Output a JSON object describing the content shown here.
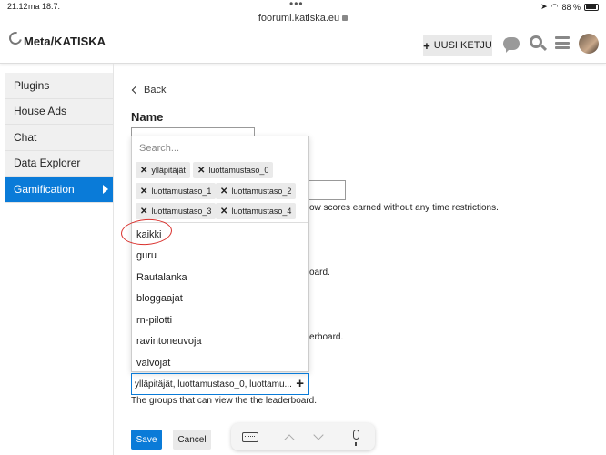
{
  "status": {
    "time": "21.12",
    "date": "ma 18.7.",
    "battery": "88 %"
  },
  "browser": {
    "url": "foorumi.katiska.eu"
  },
  "header": {
    "logo_text": "Meta/KATISKA",
    "new_topic_label": "UUSI KETJU"
  },
  "sidebar": {
    "items": [
      {
        "label": "Plugins"
      },
      {
        "label": "House Ads"
      },
      {
        "label": "Chat"
      },
      {
        "label": "Data Explorer"
      },
      {
        "label": "Gamification"
      }
    ]
  },
  "main": {
    "back_label": "Back",
    "name_title": "Name",
    "bg_text_1": "ow scores earned without any time restrictions.",
    "bg_text_2": "oard.",
    "bg_text_3": "erboard."
  },
  "group_dropdown": {
    "search_placeholder": "Search...",
    "selected_chips": [
      "ylläpitäjät",
      "luottamustaso_0",
      "luottamustaso_1",
      "luottamustaso_2",
      "luottamustaso_3",
      "luottamustaso_4"
    ],
    "options": [
      "kaikki",
      "guru",
      "Rautalanka",
      "bloggaajat",
      "rn-pilotti",
      "ravintoneuvoja",
      "valvojat"
    ]
  },
  "group_select": {
    "value": "ylläpitäjät, luottamustaso_0, luottamu...",
    "help": "The groups that can view the the leaderboard."
  },
  "buttons": {
    "save": "Save",
    "cancel": "Cancel"
  },
  "colors": {
    "accent": "#0a7bd8",
    "annotation": "#d9302c"
  }
}
